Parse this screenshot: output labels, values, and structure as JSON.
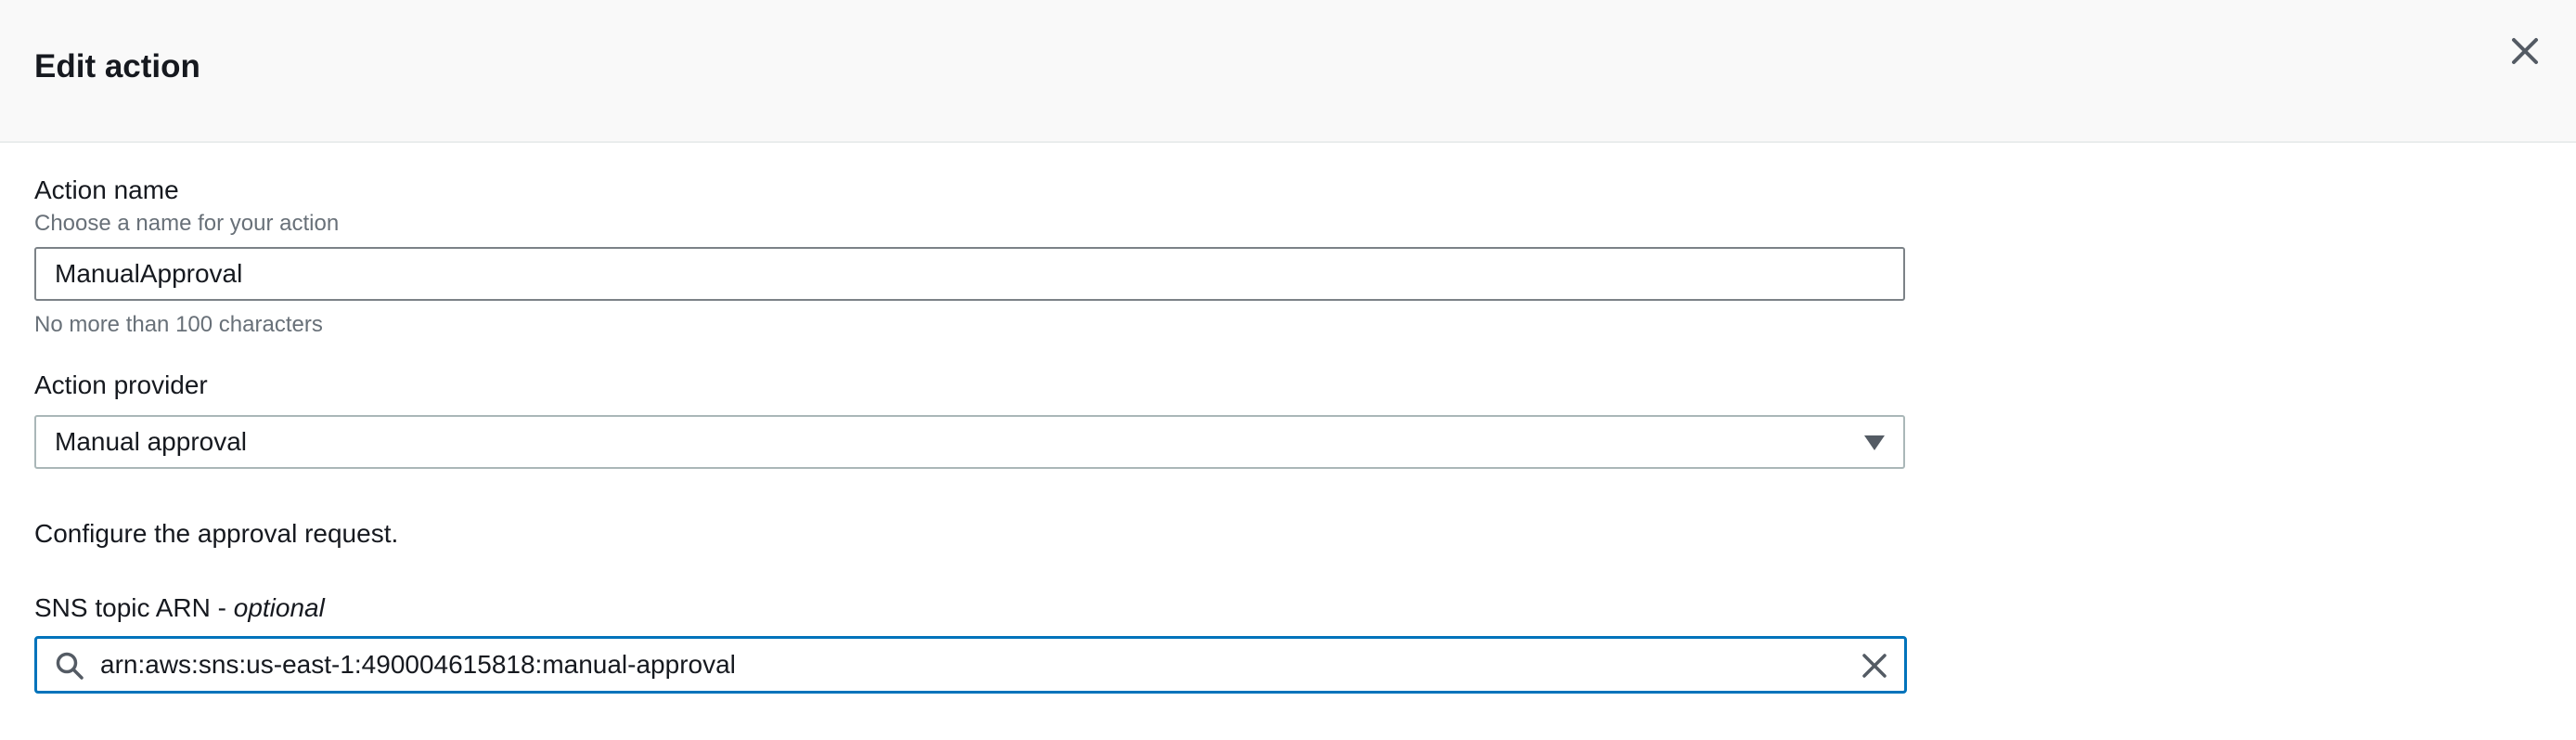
{
  "header": {
    "title": "Edit action",
    "close_icon": "close-icon"
  },
  "action_name": {
    "label": "Action name",
    "description": "Choose a name for your action",
    "value": "ManualApproval",
    "constraint": "No more than 100 characters"
  },
  "action_provider": {
    "label": "Action provider",
    "selected": "Manual approval",
    "icon": "caret-down-icon"
  },
  "approval": {
    "intro": "Configure the approval request."
  },
  "sns_topic": {
    "label": "SNS topic ARN",
    "separator": " - ",
    "optional": "optional",
    "value": "arn:aws:sns:us-east-1:490004615818:manual-approval",
    "search_icon": "search-icon",
    "clear_icon": "clear-icon"
  },
  "colors": {
    "focus_border": "#0073bb",
    "header_bg": "#f9f9f9",
    "text": "#16191f",
    "secondary_text": "#687078"
  }
}
